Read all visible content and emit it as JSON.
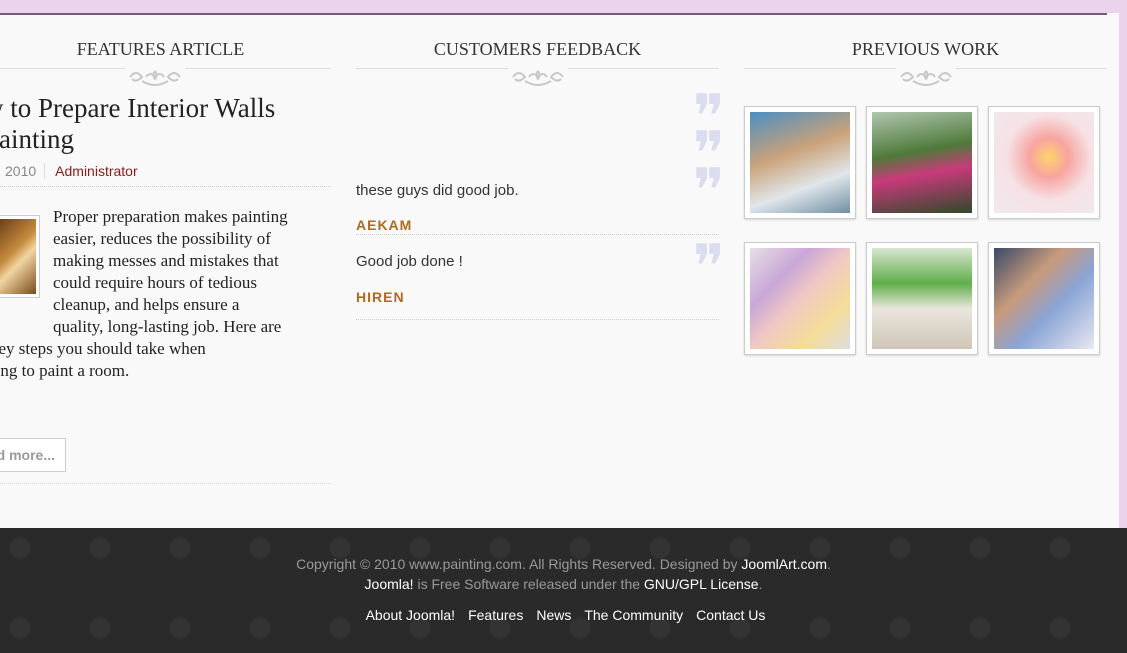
{
  "columns": {
    "features": {
      "heading": "FEATURES ARTICLE",
      "title_lines": [
        "w to Prepare Interior Walls",
        "Painting"
      ],
      "date": "2010",
      "author": "Administrator",
      "body_lines": [
        "Proper preparation makes painting",
        "easier, reduces the possibility of",
        "making messes and mistakes that",
        "could require hours of tedious",
        "cleanup, and helps ensure a",
        "quality, long-lasting job. Here are",
        "key steps you should take when",
        "ring to paint a room."
      ],
      "read_more": "d more..."
    },
    "feedback": {
      "heading": "CUSTOMERS FEEDBACK",
      "items": [
        {
          "text": "these guys did good job.",
          "author": "AEKAM"
        },
        {
          "text": "Good job done !",
          "author": "HIREN"
        }
      ]
    },
    "previous_work": {
      "heading": "PREVIOUS WORK"
    }
  },
  "footer": {
    "copyright_prefix": "Copyright © 2010 www.painting.com. All Rights Reserved. Designed by",
    "designer": "JoomlArt.com",
    "copyright_suffix": ".",
    "joomla": "Joomla!",
    "license_mid": "is Free Software released under the",
    "license": "GNU/GPL License",
    "license_suffix": ".",
    "nav": [
      "About Joomla!",
      "Features",
      "News",
      "The Community",
      "Contact Us"
    ]
  },
  "colors": {
    "accent_author": "#b06a20",
    "author_link": "#8b1a1a",
    "footer_bg": "#2a2a2a",
    "page_border": "#ecd3ec"
  }
}
